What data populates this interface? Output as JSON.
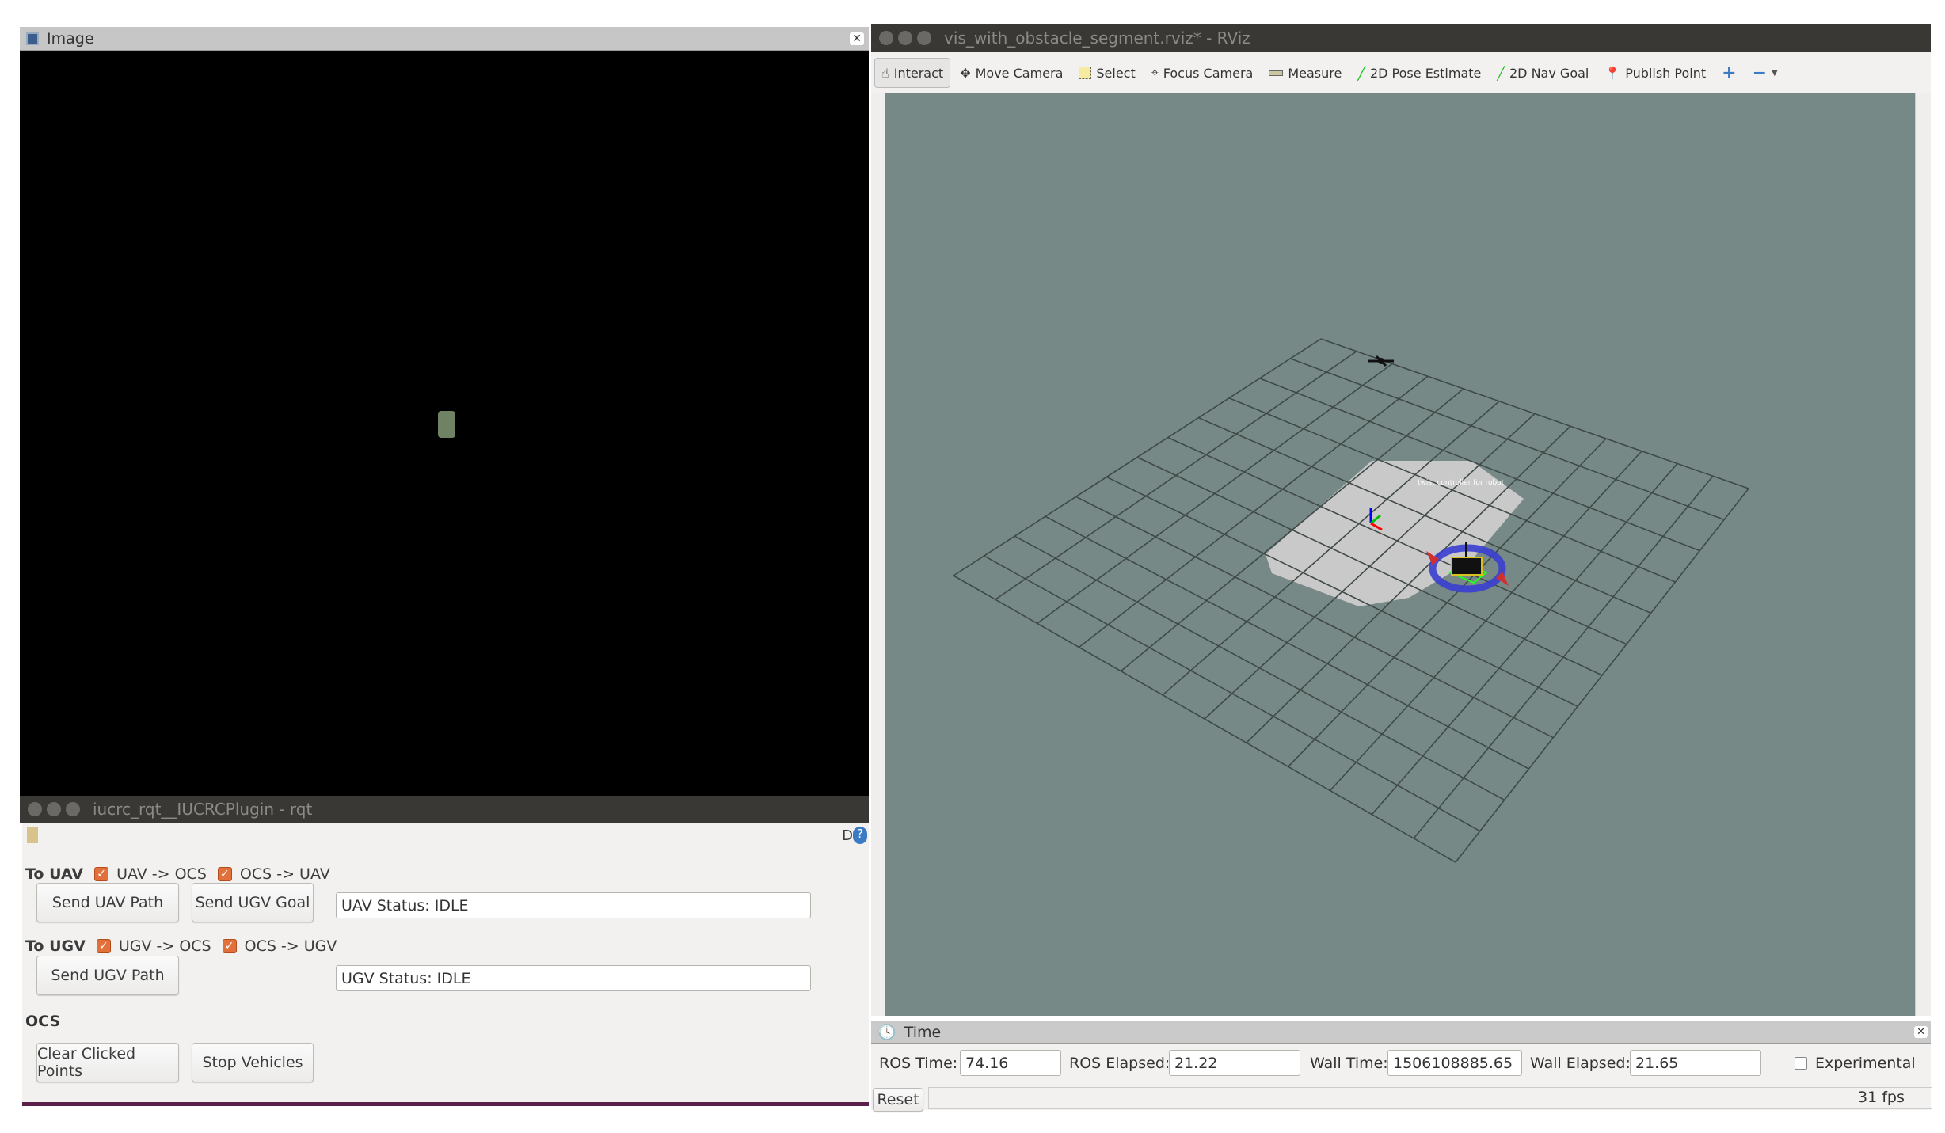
{
  "image_panel": {
    "title": "Image"
  },
  "rqt": {
    "window_title": "iucrc_rqt__IUCRCPlugin - rqt",
    "help_d": "D",
    "help_q": "?",
    "uav": {
      "label": "To UAV",
      "cb1": "UAV -> OCS",
      "cb2": "OCS -> UAV",
      "send_path": "Send UAV Path",
      "send_goal": "Send UGV Goal",
      "status": "UAV Status: IDLE"
    },
    "ugv": {
      "label": "To UGV",
      "cb1": "UGV -> OCS",
      "cb2": "OCS -> UGV",
      "send_path": "Send UGV Path",
      "status": "UGV Status: IDLE"
    },
    "ocs": {
      "label": "OCS",
      "clear": "Clear Clicked Points",
      "stop": "Stop Vehicles"
    }
  },
  "rviz": {
    "window_title": "vis_with_obstacle_segment.rviz* - RViz",
    "tools": [
      "Interact",
      "Move Camera",
      "Select",
      "Focus Camera",
      "Measure",
      "2D Pose Estimate",
      "2D Nav Goal",
      "Publish Point"
    ],
    "marker_text": "twist controller for robot",
    "time": {
      "title": "Time",
      "ros_time_label": "ROS Time:",
      "ros_time": "74.16",
      "ros_elapsed_label": "ROS Elapsed:",
      "ros_elapsed": "21.22",
      "wall_time_label": "Wall Time:",
      "wall_time": "1506108885.65",
      "wall_elapsed_label": "Wall Elapsed:",
      "wall_elapsed": "21.65",
      "experimental": "Experimental"
    },
    "reset": "Reset",
    "fps": "31 fps"
  },
  "colors": {
    "view_bg": "#778986",
    "checkbox": "#e2703a",
    "ring": "#3a3fd0"
  }
}
